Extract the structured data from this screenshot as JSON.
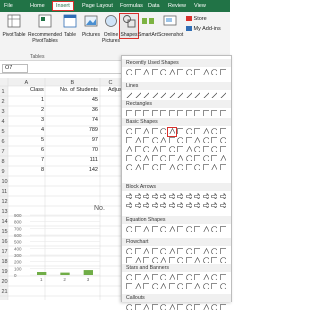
{
  "tabs": [
    "File",
    "Home",
    "Insert",
    "Page Layout",
    "Formulas",
    "Data",
    "Review",
    "View"
  ],
  "ribbon": {
    "pivottable": "PivotTable",
    "recommended": "Recommended\nPivotTables",
    "table": "Table",
    "pictures": "Pictures",
    "online": "Online\nPictures",
    "shapes": "Shapes",
    "smartart": "SmartArt",
    "screenshot": "Screenshot",
    "store": "Store",
    "addins": "My Add-ins",
    "group_tables": "Tables"
  },
  "namebox": "O7",
  "columns": [
    "A",
    "B",
    "C"
  ],
  "rows": [
    "1",
    "2",
    "3",
    "4",
    "5",
    "6",
    "7",
    "8",
    "9",
    "10",
    "11",
    "12",
    "13",
    "14",
    "15",
    "16",
    "17",
    "18",
    "19",
    "20",
    "21"
  ],
  "table": {
    "headers": [
      "Class",
      "No. of Students",
      "Adjus"
    ],
    "data": [
      [
        "1",
        "45"
      ],
      [
        "2",
        "36"
      ],
      [
        "3",
        "74"
      ],
      [
        "4",
        "789"
      ],
      [
        "5",
        "97"
      ],
      [
        "6",
        "70"
      ],
      [
        "7",
        "111"
      ],
      [
        "8",
        "142"
      ]
    ]
  },
  "chart_title_fragment": "No.",
  "chart_data": {
    "type": "bar",
    "categories": [
      "1",
      "2",
      "3"
    ],
    "values": [
      45,
      36,
      74
    ],
    "ylim": [
      0,
      900
    ],
    "yticks": [
      "900",
      "800",
      "700",
      "600",
      "500",
      "400",
      "300",
      "200",
      "100",
      "0"
    ]
  },
  "shapes_panel": {
    "sections": [
      "Recently Used Shapes",
      "Lines",
      "Rectangles",
      "Basic Shapes",
      "Block Arrows",
      "Equation Shapes",
      "Flowchart",
      "Stars and Banners",
      "Callouts"
    ]
  },
  "colors": {
    "excel_green": "#217346",
    "highlight_red": "#d9302b",
    "bar_green": "#70ad47"
  }
}
